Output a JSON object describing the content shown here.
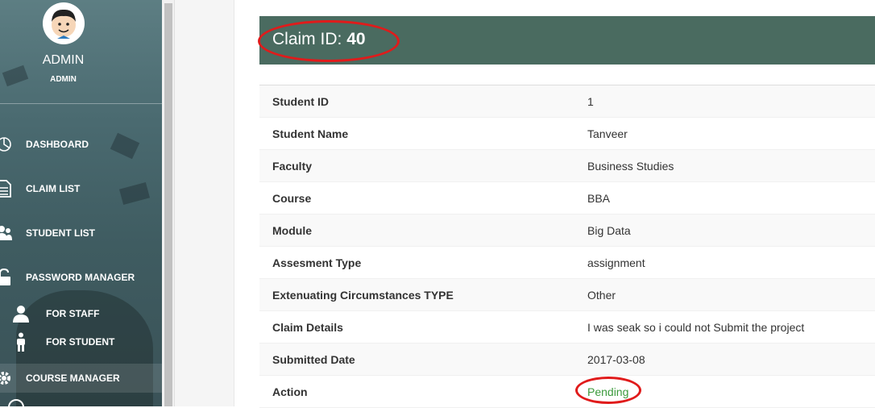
{
  "sidebar": {
    "admin_name": "ADMIN",
    "admin_role": "ADMIN",
    "items": [
      {
        "label": "DASHBOARD",
        "icon": "dashboard-icon"
      },
      {
        "label": "CLAIM LIST",
        "icon": "document-icon"
      },
      {
        "label": "STUDENT LIST",
        "icon": "users-icon"
      },
      {
        "label": "PASSWORD MANAGER",
        "icon": "unlock-icon"
      },
      {
        "label": "FOR STAFF",
        "icon": "user-icon"
      },
      {
        "label": "FOR STUDENT",
        "icon": "student-icon"
      },
      {
        "label": "COURSE MANAGER",
        "icon": "gear-icon"
      }
    ]
  },
  "claim": {
    "label": "Claim ID: ",
    "id": "40"
  },
  "details": [
    {
      "key": "Student ID",
      "value": "1"
    },
    {
      "key": "Student Name",
      "value": "Tanveer"
    },
    {
      "key": "Faculty",
      "value": "Business Studies"
    },
    {
      "key": "Course",
      "value": "BBA"
    },
    {
      "key": "Module",
      "value": "Big Data"
    },
    {
      "key": "Assesment Type",
      "value": "assignment"
    },
    {
      "key": "Extenuating Circumstances TYPE",
      "value": "Other"
    },
    {
      "key": "Claim Details",
      "value": "I was seak so i could not Submit the project"
    },
    {
      "key": "Submitted Date",
      "value": "2017-03-08"
    },
    {
      "key": "Action",
      "value": "Pending"
    }
  ],
  "colors": {
    "header_bg": "#4a6b60",
    "pending": "#3c9a3c",
    "annotation": "#e01b1b"
  }
}
